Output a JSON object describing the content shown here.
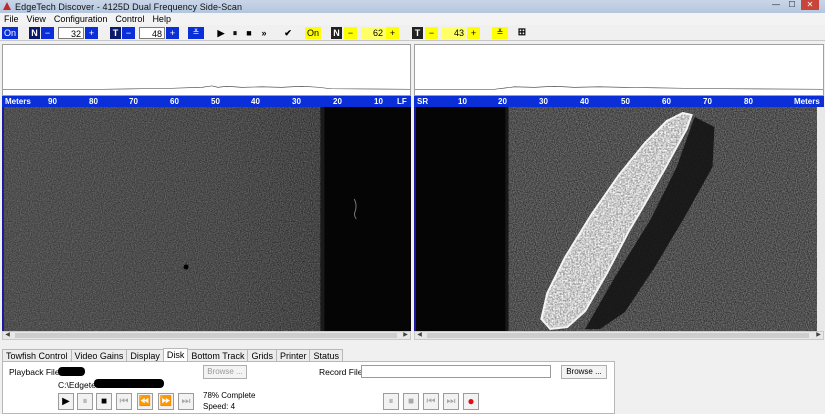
{
  "window": {
    "title": "EdgeTech  Discover - 4125D  Dual Frequency Side-Scan",
    "controls": [
      "—",
      "☐",
      "✕"
    ]
  },
  "menu": [
    "File",
    "View",
    "Configuration",
    "Control",
    "Help"
  ],
  "toolbar_left": {
    "on_label": "On",
    "n_label": "N",
    "n_minus": "−",
    "n_value": "32",
    "n_plus": "+",
    "t_label": "T",
    "t_minus": "−",
    "t_value": "48",
    "t_plus": "+"
  },
  "toolbar_playback": [
    "▶",
    "⏸",
    "■",
    "»"
  ],
  "toolbar_right": {
    "check": "✔",
    "on_label": "On",
    "n_label": "N",
    "n_minus": "−",
    "n_value": "62",
    "n_plus": "+",
    "t_label": "T",
    "t_minus": "−",
    "t_value": "43",
    "t_plus": "+"
  },
  "scale_left": {
    "unit": "Meters",
    "ticks": [
      "90",
      "80",
      "70",
      "60",
      "50",
      "40",
      "30",
      "20",
      "10"
    ],
    "side": "LF"
  },
  "scale_right": {
    "side": "SR",
    "ticks": [
      "10",
      "20",
      "30",
      "40",
      "50",
      "60",
      "70",
      "80"
    ],
    "unit": "Meters"
  },
  "tabs": [
    "Towfish Control",
    "Video Gains",
    "Display",
    "Disk",
    "Bottom Track",
    "Grids",
    "Printer",
    "Status"
  ],
  "active_tab": "Disk",
  "disk": {
    "playback_label": "Playback File:",
    "path_prefix": "C:\\Edgetech\\",
    "browse_label": "Browse ...",
    "progress_text": "78% Complete",
    "speed_text": "Speed: 4",
    "record_label": "Record File:",
    "record_browse_label": "Browse ..."
  },
  "playback_controls": [
    "▶",
    "⏸",
    "■",
    "⏮",
    "⏪",
    "⏩",
    "⏭"
  ],
  "record_controls": [
    "⏸",
    "■",
    "⏮",
    "⏭",
    "●"
  ],
  "colors": {
    "scale_bar": "#0a2fd8",
    "highlight_yellow": "#ffff00",
    "record_red": "#e01010"
  }
}
